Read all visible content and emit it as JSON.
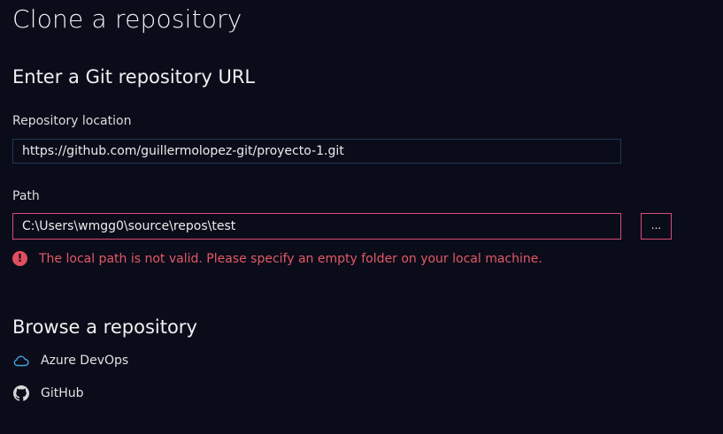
{
  "page": {
    "title": "Clone a repository"
  },
  "url_section": {
    "heading": "Enter a Git repository URL",
    "repo_label": "Repository location",
    "repo_value": "https://github.com/guillermolopez-git/proyecto-1.git",
    "path_label": "Path",
    "path_value": "C:\\Users\\wmgg0\\source\\repos\\test",
    "browse_label": "...",
    "error_icon": "!",
    "error_message": "The local path is not valid. Please specify an empty folder on your local machine.",
    "colors": {
      "error": "#e55865",
      "field_border_error": "#d94c78",
      "field_border": "#1c3a55"
    }
  },
  "browse_section": {
    "heading": "Browse a repository",
    "providers": [
      {
        "label": "Azure DevOps",
        "icon": "cloud-icon"
      },
      {
        "label": "GitHub",
        "icon": "github-icon"
      }
    ]
  }
}
